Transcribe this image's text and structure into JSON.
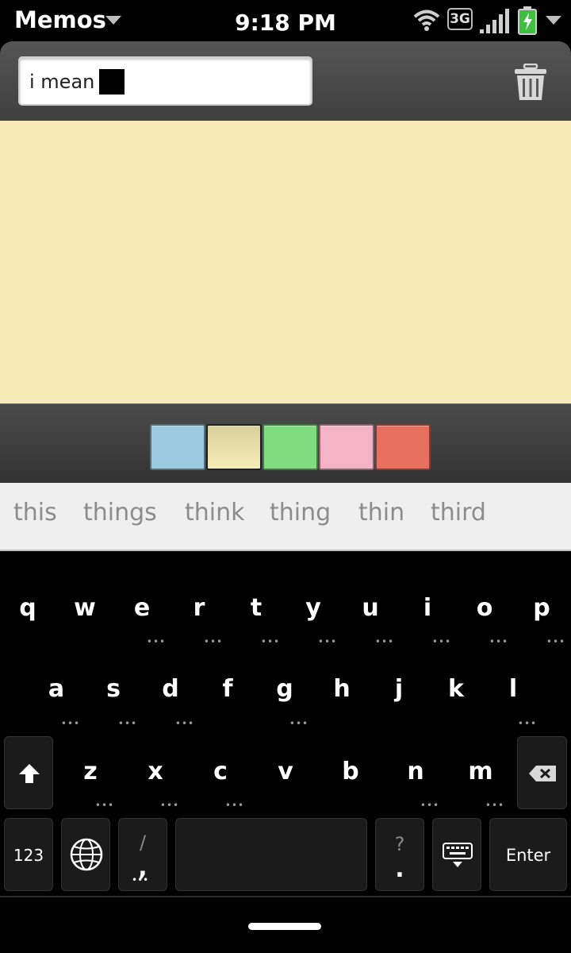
{
  "status_bar": {
    "app_name": "Memos",
    "time": "9:18 PM",
    "network": "3G",
    "icons": [
      "wifi-icon",
      "signal-icon",
      "battery-charging-icon",
      "chevron-down-icon"
    ]
  },
  "memo": {
    "title": "i mean",
    "note_color": "#f6ebb6",
    "delete_icon": "trash-icon"
  },
  "color_picker": {
    "colors": [
      {
        "name": "blue",
        "color": "#9ccbe1"
      },
      {
        "name": "yellow",
        "color": "#f3e9b3",
        "selected": true
      },
      {
        "name": "green",
        "color": "#7fdc7f"
      },
      {
        "name": "pink",
        "color": "#f5b3c8"
      },
      {
        "name": "red",
        "color": "#e8705f"
      }
    ]
  },
  "suggestions": [
    "this",
    "things",
    "think",
    "thing",
    "thin",
    "third"
  ],
  "keyboard": {
    "row1": [
      "q",
      "w",
      "e",
      "r",
      "t",
      "y",
      "u",
      "i",
      "o",
      "p"
    ],
    "row2": [
      "a",
      "s",
      "d",
      "f",
      "g",
      "h",
      "j",
      "k",
      "l"
    ],
    "row3": [
      "z",
      "x",
      "c",
      "v",
      "b",
      "n",
      "m"
    ],
    "numbers_label": "123",
    "slash_label": "/",
    "comma_label": ",",
    "question_label": "?",
    "period_label": ".",
    "enter_label": "Enter",
    "dots": "•••"
  }
}
